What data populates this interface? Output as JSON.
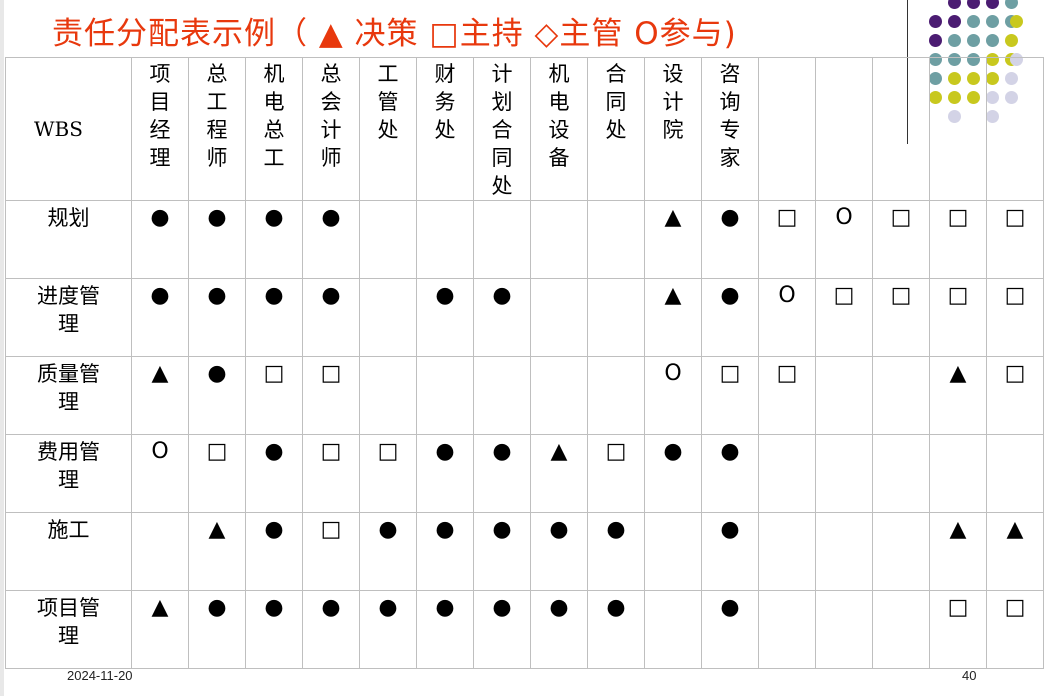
{
  "title": "责任分配表示例（ ▲ 决策 □主持 ◇主管 O参与)",
  "table": {
    "corner_label": "WBS",
    "columns": [
      "项目经理",
      "总工程师",
      "机电总工",
      "总会计师",
      "工管处",
      "财务处",
      "计划合同处",
      "机电设备",
      "合同处",
      "设计院",
      "咨询专家",
      "",
      "",
      "",
      "",
      ""
    ],
    "rows": [
      {
        "label": "规划",
        "cells": [
          "●",
          "●",
          "●",
          "●",
          "",
          "",
          "",
          "",
          "",
          "▲",
          "●",
          "□",
          "O",
          "□",
          "□",
          "□"
        ]
      },
      {
        "label": "进度管理",
        "cells": [
          "●",
          "●",
          "●",
          "●",
          "",
          "●",
          "●",
          "",
          "",
          "▲",
          "●",
          "O",
          "□",
          "□",
          "□",
          "□"
        ]
      },
      {
        "label": "质量管理",
        "cells": [
          "▲",
          "●",
          "□",
          "□",
          "",
          "",
          "",
          "",
          "",
          "O",
          "□",
          "□",
          "",
          "",
          "▲",
          "□"
        ]
      },
      {
        "label": "费用管理",
        "cells": [
          "O",
          "□",
          "●",
          "□",
          "□",
          "●",
          "●",
          "▲",
          "□",
          "●",
          "●",
          "",
          "",
          "",
          "",
          ""
        ]
      },
      {
        "label": "施工",
        "cells": [
          "",
          "▲",
          "●",
          "□",
          "●",
          "●",
          "●",
          "●",
          "●",
          "",
          "●",
          "",
          "",
          "",
          "▲",
          "▲"
        ]
      },
      {
        "label": "项目管理",
        "cells": [
          "▲",
          "●",
          "●",
          "●",
          "●",
          "●",
          "●",
          "●",
          "●",
          "",
          "●",
          "",
          "",
          "",
          "□",
          "□"
        ]
      }
    ]
  },
  "decor": {
    "dot_colors": {
      "purple": "#4b1c72",
      "teal": "#6e9fa3",
      "olive": "#c8c81e",
      "lavender": "#d3d3e6"
    }
  },
  "footer": {
    "date": "2024-11-20",
    "page": "40"
  }
}
